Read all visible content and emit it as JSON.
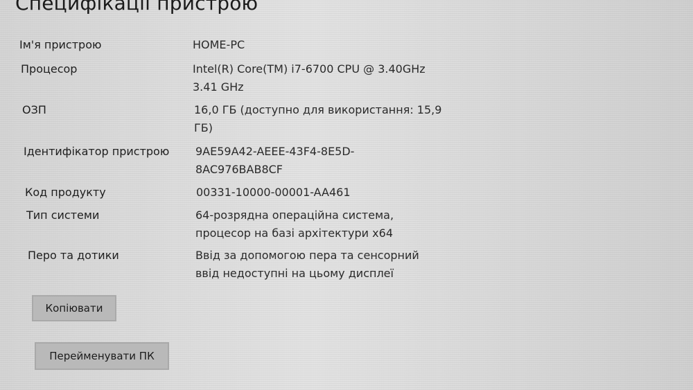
{
  "header": {
    "title": "Специфікації пристрою"
  },
  "specs": [
    {
      "label": "Ім'я пристрою",
      "value": "HOME-PC"
    },
    {
      "label": "Процесор",
      "value": "Intel(R) Core(TM) i7-6700 CPU @ 3.40GHz 3.41 GHz"
    },
    {
      "label": "ОЗП",
      "value": "16,0 ГБ (доступно для використання: 15,9 ГБ)"
    },
    {
      "label": "Ідентифікатор пристрою",
      "value": "9AE59A42-AEEE-43F4-8E5D-8AC976BAB8CF"
    },
    {
      "label": "Код продукту",
      "value": "00331-10000-00001-AA461"
    },
    {
      "label": "Тип системи",
      "value": "64-розрядна операційна система, процесор на базі архітектури x64"
    },
    {
      "label": "Перо та дотики",
      "value": "Ввід за допомогою пера та сенсорний ввід недоступні на цьому дисплеї"
    }
  ],
  "actions": {
    "copy_label": "Копіювати",
    "rename_label": "Перейменувати ПК"
  }
}
